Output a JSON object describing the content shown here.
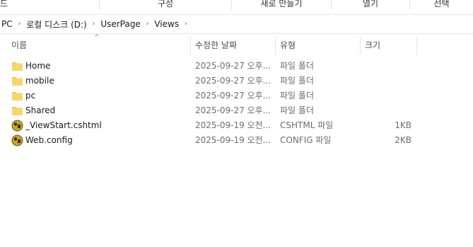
{
  "ribbon": {
    "groups": [
      "드",
      "구성",
      "새로 만들기",
      "열기",
      "선택"
    ]
  },
  "address": {
    "crumbs": [
      "PC",
      "로컬 디스크 (D:)",
      "UserPage",
      "Views"
    ],
    "separator": "›"
  },
  "columns": {
    "name": "이름",
    "date": "수정한 날짜",
    "type": "유형",
    "size": "크기",
    "sort_arrow": "^"
  },
  "files": [
    {
      "name": "Home",
      "date": "2025-09-27 오후...",
      "type": "파일 폴더",
      "size": "",
      "icon": "folder-icon"
    },
    {
      "name": "mobile",
      "date": "2025-09-27 오후...",
      "type": "파일 폴더",
      "size": "",
      "icon": "folder-icon"
    },
    {
      "name": "pc",
      "date": "2025-09-27 오후...",
      "type": "파일 폴더",
      "size": "",
      "icon": "folder-icon"
    },
    {
      "name": "Shared",
      "date": "2025-09-27 오후...",
      "type": "파일 폴더",
      "size": "",
      "icon": "folder-icon"
    },
    {
      "name": "_ViewStart.cshtml",
      "date": "2025-09-19 오전...",
      "type": "CSHTML 파일",
      "size": "1KB",
      "icon": "visual-studio-file-icon"
    },
    {
      "name": "Web.config",
      "date": "2025-09-19 오전...",
      "type": "CONFIG 파일",
      "size": "2KB",
      "icon": "visual-studio-file-icon"
    }
  ],
  "colors": {
    "folder": "#f3c64c",
    "folder_dark": "#e0a82e",
    "vs_circle": "#b8860b",
    "header_text": "#4d4d4d",
    "meta_text": "#6d6d6d"
  }
}
